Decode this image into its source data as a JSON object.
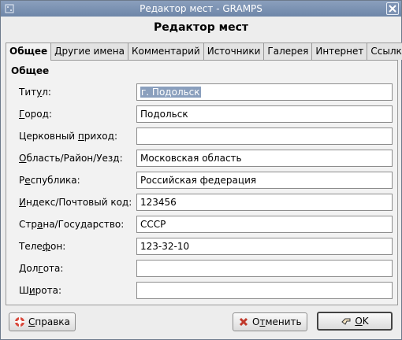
{
  "window": {
    "title": "Редактор мест - GRAMPS"
  },
  "heading": "Редактор мест",
  "tabs": [
    {
      "label": "Общее",
      "active": true
    },
    {
      "label": "Другие имена",
      "active": false
    },
    {
      "label": "Комментарий",
      "active": false
    },
    {
      "label": "Источники",
      "active": false
    },
    {
      "label": "Галерея",
      "active": false
    },
    {
      "label": "Интернет",
      "active": false
    },
    {
      "label": "Ссылки",
      "active": false
    }
  ],
  "section": {
    "title": "Общее"
  },
  "fields": [
    {
      "pre": "Тит",
      "ul": "у",
      "post": "л:",
      "value": "г. Подольск",
      "selected": true
    },
    {
      "pre": "",
      "ul": "Г",
      "post": "ород:",
      "value": "Подольск"
    },
    {
      "pre": "Церковный ",
      "ul": "п",
      "post": "риход:",
      "value": ""
    },
    {
      "pre": "",
      "ul": "О",
      "post": "бласть/Район/Уезд:",
      "value": "Московская область"
    },
    {
      "pre": "Р",
      "ul": "е",
      "post": "спублика:",
      "value": "Российская федерация"
    },
    {
      "pre": "",
      "ul": "И",
      "post": "ндекс/Почтовый код:",
      "value": "123456"
    },
    {
      "pre": "Стр",
      "ul": "а",
      "post": "на/Государство:",
      "value": "СССР"
    },
    {
      "pre": "Теле",
      "ul": "ф",
      "post": "он:",
      "value": "123-32-10"
    },
    {
      "pre": "Дол",
      "ul": "г",
      "post": "ота:",
      "value": ""
    },
    {
      "pre": "Ш",
      "ul": "и",
      "post": "рота:",
      "value": ""
    }
  ],
  "buttons": {
    "help": {
      "ul": "С",
      "post": "правка"
    },
    "cancel": {
      "pre": "О",
      "ul": "т",
      "post": "менить"
    },
    "ok": {
      "ul": "О",
      "post": "K"
    }
  },
  "colors": {
    "titlebar": "#7c93b5",
    "selection": "#8a9fbd",
    "cancel_icon": "#c0392b"
  }
}
